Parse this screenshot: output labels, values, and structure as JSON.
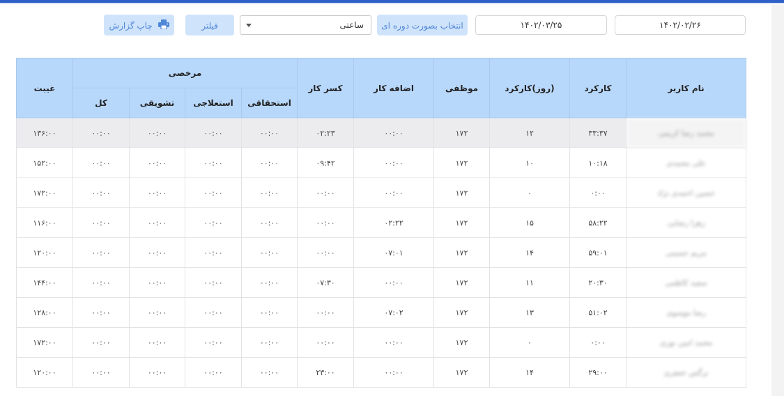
{
  "toolbar": {
    "date_from": "۱۴۰۲/۰۲/۲۶",
    "date_to": "۱۴۰۲/۰۳/۲۵",
    "period_button": "انتخاب بصورت دوره ای",
    "unit_select_value": "ساعتی",
    "filter_button": "فیلتر",
    "print_button": "چاپ گزارش"
  },
  "table": {
    "headers": {
      "user_name": "نام کاربر",
      "work": "کارکرد",
      "work_days": "(روز)کارکرد",
      "required": "موظفی",
      "overtime": "اضافه کار",
      "deficit": "کسر کار",
      "leave": "مرخصی",
      "leave_entitled": "استحقاقی",
      "leave_sick": "استعلاجی",
      "leave_incentive": "تشویقی",
      "leave_total": "کل",
      "absence": "غیبت"
    },
    "rows": [
      {
        "name": "محمد رضا کریمی",
        "work": "۳۳:۳۷",
        "days": "۱۲",
        "required": "۱۷۲",
        "overtime": "۰۰:۰۰",
        "deficit": "۰۲:۲۳",
        "entitled": "۰۰:۰۰",
        "sick": "۰۰:۰۰",
        "incentive": "۰۰:۰۰",
        "total": "۰۰:۰۰",
        "absence": "۱۳۶:۰۰"
      },
      {
        "name": "علی محمدی",
        "work": "۱۰:۱۸",
        "days": "۱۰",
        "required": "۱۷۲",
        "overtime": "۰۰:۰۰",
        "deficit": "۰۹:۴۲",
        "entitled": "۰۰:۰۰",
        "sick": "۰۰:۰۰",
        "incentive": "۰۰:۰۰",
        "total": "۰۰:۰۰",
        "absence": "۱۵۲:۰۰"
      },
      {
        "name": "حسین احمدی نژاد",
        "work": "۰:۰۰",
        "days": "۰",
        "required": "۱۷۲",
        "overtime": "۰۰:۰۰",
        "deficit": "۰۰:۰۰",
        "entitled": "۰۰:۰۰",
        "sick": "۰۰:۰۰",
        "incentive": "۰۰:۰۰",
        "total": "۰۰:۰۰",
        "absence": "۱۷۲:۰۰"
      },
      {
        "name": "زهرا رضایی",
        "work": "۵۸:۲۲",
        "days": "۱۵",
        "required": "۱۷۲",
        "overtime": "۰۲:۲۲",
        "deficit": "۰۰:۰۰",
        "entitled": "۰۰:۰۰",
        "sick": "۰۰:۰۰",
        "incentive": "۰۰:۰۰",
        "total": "۰۰:۰۰",
        "absence": "۱۱۶:۰۰"
      },
      {
        "name": "مریم حسینی",
        "work": "۵۹:۰۱",
        "days": "۱۴",
        "required": "۱۷۲",
        "overtime": "۰۷:۰۱",
        "deficit": "۰۰:۰۰",
        "entitled": "۰۰:۰۰",
        "sick": "۰۰:۰۰",
        "incentive": "۰۰:۰۰",
        "total": "۰۰:۰۰",
        "absence": "۱۲۰:۰۰"
      },
      {
        "name": "سعید کاظمی",
        "work": "۲۰:۳۰",
        "days": "۱۱",
        "required": "۱۷۲",
        "overtime": "۰۰:۰۰",
        "deficit": "۰۷:۳۰",
        "entitled": "۰۰:۰۰",
        "sick": "۰۰:۰۰",
        "incentive": "۰۰:۰۰",
        "total": "۰۰:۰۰",
        "absence": "۱۴۴:۰۰"
      },
      {
        "name": "رضا موسوی",
        "work": "۵۱:۰۲",
        "days": "۱۳",
        "required": "۱۷۲",
        "overtime": "۰۷:۰۲",
        "deficit": "۰۰:۰۰",
        "entitled": "۰۰:۰۰",
        "sick": "۰۰:۰۰",
        "incentive": "۰۰:۰۰",
        "total": "۰۰:۰۰",
        "absence": "۱۲۸:۰۰"
      },
      {
        "name": "محمد امین نوری",
        "work": "۰:۰۰",
        "days": "۰",
        "required": "۱۷۲",
        "overtime": "۰۰:۰۰",
        "deficit": "۰۰:۰۰",
        "entitled": "۰۰:۰۰",
        "sick": "۰۰:۰۰",
        "incentive": "۰۰:۰۰",
        "total": "۰۰:۰۰",
        "absence": "۱۷۲:۰۰"
      },
      {
        "name": "نرگس جعفری",
        "work": "۲۹:۰۰",
        "days": "۱۴",
        "required": "۱۷۲",
        "overtime": "۰۰:۰۰",
        "deficit": "۲۳:۰۰",
        "entitled": "۰۰:۰۰",
        "sick": "۰۰:۰۰",
        "incentive": "۰۰:۰۰",
        "total": "۰۰:۰۰",
        "absence": "۱۲۰:۰۰"
      }
    ]
  },
  "colors": {
    "header_bg": "#b8d8fb",
    "button_bg": "#cfe3fb",
    "button_text": "#4f87d8",
    "top_bar": "#2f5fc8"
  },
  "icons": {
    "print": "printer-icon",
    "select_caret": "caret-down-icon"
  }
}
